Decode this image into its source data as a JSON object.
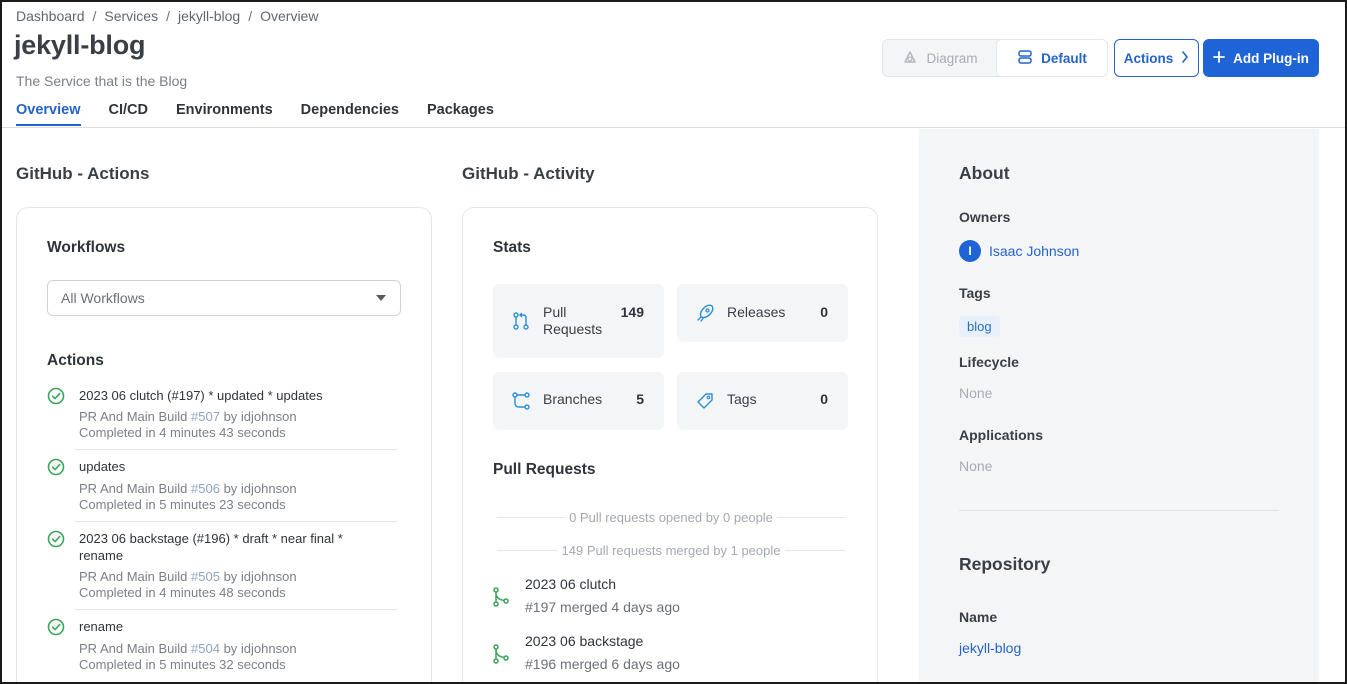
{
  "breadcrumb": [
    "Dashboard",
    "Services",
    "jekyll-blog",
    "Overview"
  ],
  "page": {
    "title": "jekyll-blog",
    "subtitle": "The Service that is the Blog"
  },
  "tabs": [
    {
      "label": "Overview",
      "active": true
    },
    {
      "label": "CI/CD",
      "active": false
    },
    {
      "label": "Environments",
      "active": false
    },
    {
      "label": "Dependencies",
      "active": false
    },
    {
      "label": "Packages",
      "active": false
    }
  ],
  "header_buttons": {
    "diagram": "Diagram",
    "default": "Default",
    "actions": "Actions",
    "add_plugin": "Add Plug-in"
  },
  "github_actions": {
    "section_title": "GitHub - Actions",
    "workflows_heading": "Workflows",
    "workflow_select": "All Workflows",
    "actions_heading": "Actions",
    "items": [
      {
        "title": "2023 06 clutch (#197) * updated * updates",
        "build": "PR And Main Build",
        "run": "#507",
        "by": "by idjohnson",
        "completed": "Completed in 4 minutes 43 seconds"
      },
      {
        "title": "updates",
        "build": "PR And Main Build",
        "run": "#506",
        "by": "by idjohnson",
        "completed": "Completed in 5 minutes 23 seconds"
      },
      {
        "title": "2023 06 backstage (#196) * draft * near final * rename",
        "build": "PR And Main Build",
        "run": "#505",
        "by": "by idjohnson",
        "completed": "Completed in 4 minutes 48 seconds"
      },
      {
        "title": "rename",
        "build": "PR And Main Build",
        "run": "#504",
        "by": "by idjohnson",
        "completed": "Completed in 5 minutes 32 seconds"
      }
    ]
  },
  "github_activity": {
    "section_title": "GitHub - Activity",
    "stats_heading": "Stats",
    "stats": [
      {
        "label": "Pull Requests",
        "value": "149",
        "icon": "pull-request-icon"
      },
      {
        "label": "Releases",
        "value": "0",
        "icon": "rocket-icon"
      },
      {
        "label": "Branches",
        "value": "5",
        "icon": "branch-icon"
      },
      {
        "label": "Tags",
        "value": "0",
        "icon": "tag-icon"
      }
    ],
    "pr_heading": "Pull Requests",
    "pr_opened": "0 Pull requests opened by 0 people",
    "pr_merged": "149 Pull requests merged by 1 people",
    "pull_requests": [
      {
        "title": "2023 06 clutch",
        "sub": "#197 merged 4 days ago"
      },
      {
        "title": "2023 06 backstage",
        "sub": "#196 merged 6 days ago"
      }
    ]
  },
  "about": {
    "title": "About",
    "owners_label": "Owners",
    "owner_initial": "I",
    "owner_name": "Isaac Johnson",
    "tags_label": "Tags",
    "tag": "blog",
    "lifecycle_label": "Lifecycle",
    "lifecycle_value": "None",
    "applications_label": "Applications",
    "applications_value": "None",
    "repository_title": "Repository",
    "name_label": "Name",
    "repo_name": "jekyll-blog"
  },
  "colors": {
    "accent": "#2563c9",
    "success": "#3aa55a",
    "panel_bg": "#f4f5f7"
  }
}
